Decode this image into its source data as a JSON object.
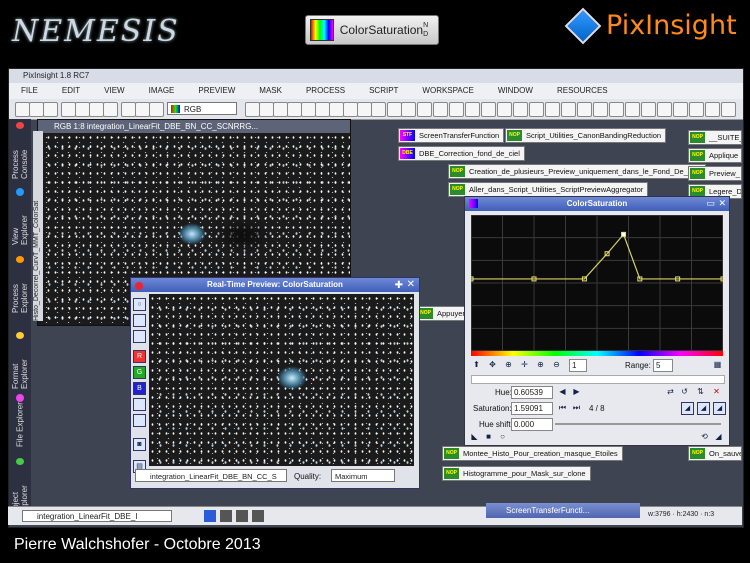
{
  "slide": {
    "logo_left": "NEMESIS",
    "logo_left_sub": "",
    "process_badge": "ColorSaturation",
    "process_badge_corner": "N D",
    "logo_right": "PixInsight",
    "caption": "Pierre Walchshofer - Octobre 2013"
  },
  "app": {
    "title": "PixInsight 1.8 RC7",
    "menu": [
      "FILE",
      "EDIT",
      "VIEW",
      "IMAGE",
      "PREVIEW",
      "MASK",
      "PROCESS",
      "SCRIPT",
      "WORKSPACE",
      "WINDOW",
      "RESOURCES"
    ],
    "rgb_select": "RGB",
    "sidebar_tabs": [
      "Process Console",
      "View Explorer",
      "Process Explorer",
      "Format Explorer",
      "File Explorer",
      "Object Explorer"
    ],
    "side_strip": "Histo_Decorrel_CurvT_MMT_ColorSat"
  },
  "image_window": {
    "title": "RGB 1:8 integration_LinearFit_DBE_BN_CC_SCNRRG..."
  },
  "process_icons": [
    {
      "label": "ScreenTransferFunction",
      "badge": "STF"
    },
    {
      "label": "Script_Utilities_CanonBandingReduction",
      "badge": "NOP"
    },
    {
      "label": "__SUITE_",
      "badge": "NOP"
    },
    {
      "label": "DBE_Correction_fond_de_ciel",
      "badge": "DBE"
    },
    {
      "label": "Applique",
      "badge": "NOP"
    },
    {
      "label": "Creation_de_plusieurs_Preview_uniquement_dans_le_Fond_De_Ciel",
      "badge": "NOP"
    },
    {
      "label": "Preview_",
      "badge": "NOP"
    },
    {
      "label": "Aller_dans_Script_Utilities_ScriptPreviewAggregator",
      "badge": "NOP"
    },
    {
      "label": "Legere_D",
      "badge": "NOP"
    },
    {
      "label": "Appuyer_l",
      "badge": "NOP"
    },
    {
      "label": "Montee_Histo_Pour_creation_masque_Etoiles",
      "badge": "NOP"
    },
    {
      "label": "On_sauve",
      "badge": "NOP"
    },
    {
      "label": "Histogramme_pour_Mask_sur_clone",
      "badge": "NOP"
    }
  ],
  "realtime_preview": {
    "title": "Real-Time Preview: ColorSaturation",
    "view_select": "integration_LinearFit_DBE_BN_CC_S",
    "quality_label": "Quality:",
    "quality_value": "Maximum"
  },
  "color_saturation": {
    "title": "ColorSaturation",
    "zoom_value": "1",
    "range_label": "Range:",
    "range_value": "5",
    "hue_label": "Hue:",
    "hue_value": "0.60539",
    "saturation_label": "Saturation:",
    "saturation_value": "1.59091",
    "point_counter": "4 / 8",
    "hue_shift_label": "Hue shift:",
    "hue_shift_value": "0.000",
    "curve_points": [
      {
        "hue": 0.0,
        "sat": 0.0
      },
      {
        "hue": 0.25,
        "sat": 0.0
      },
      {
        "hue": 0.45,
        "sat": 0.0
      },
      {
        "hue": 0.54,
        "sat": 0.9
      },
      {
        "hue": 0.60539,
        "sat": 1.59091
      },
      {
        "hue": 0.67,
        "sat": 0.0
      },
      {
        "hue": 0.82,
        "sat": 0.0
      },
      {
        "hue": 1.0,
        "sat": 0.0
      }
    ]
  },
  "bottom": {
    "view_select": "integration_LinearFit_DBE_I",
    "minimized": "ScreenTransferFuncti...",
    "coords": "w:3796 · h:2430 · n:3"
  }
}
